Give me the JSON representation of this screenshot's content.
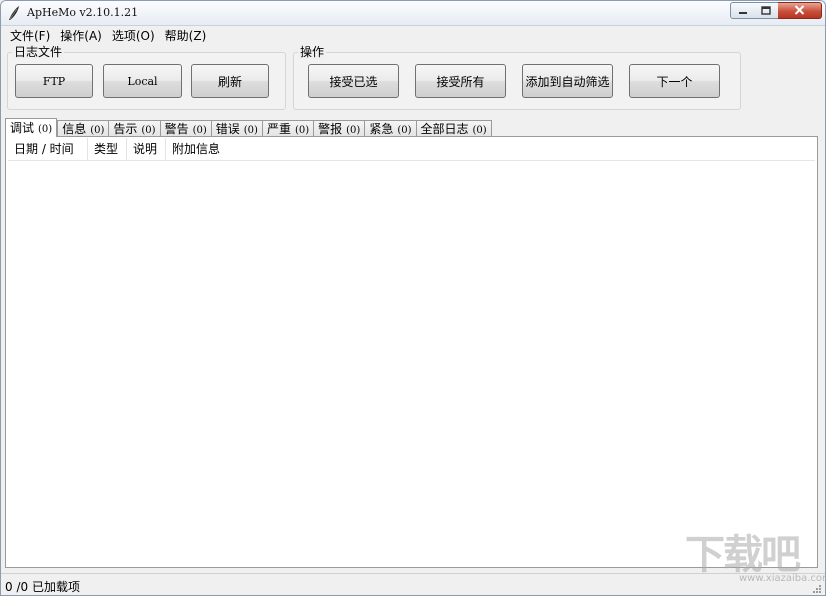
{
  "window": {
    "title": "ApHeMo v2.10.1.21"
  },
  "menu": [
    {
      "label": "文件(F)"
    },
    {
      "label": "操作(A)"
    },
    {
      "label": "选项(O)"
    },
    {
      "label": "帮助(Z)"
    }
  ],
  "log_group": {
    "label": "日志文件",
    "buttons": {
      "ftp": "FTP",
      "local": "Local",
      "refresh": "刷新"
    }
  },
  "action_group": {
    "label": "操作",
    "buttons": {
      "accept_selected": "接受已选",
      "accept_all": "接受所有",
      "add_autofilter": "添加到自动筛选",
      "next": "下一个"
    }
  },
  "tabs": [
    {
      "label": "调试",
      "count": "(0)"
    },
    {
      "label": "信息",
      "count": "(0)"
    },
    {
      "label": "告示",
      "count": "(0)"
    },
    {
      "label": "警告",
      "count": "(0)"
    },
    {
      "label": "错误",
      "count": "(0)"
    },
    {
      "label": "严重",
      "count": "(0)"
    },
    {
      "label": "警报",
      "count": "(0)"
    },
    {
      "label": "紧急",
      "count": "(0)"
    },
    {
      "label": "全部日志",
      "count": "(0)"
    }
  ],
  "columns": [
    {
      "label": "日期 / 时间"
    },
    {
      "label": "类型"
    },
    {
      "label": "说明"
    },
    {
      "label": "附加信息"
    }
  ],
  "status": {
    "text": "0 /0 已加载项"
  },
  "watermark": {
    "main": "下载吧",
    "sub": "www.xiazaiba.com"
  },
  "colors": {
    "close_button": "#c9503b",
    "panel_border": "#9a9a9a"
  }
}
